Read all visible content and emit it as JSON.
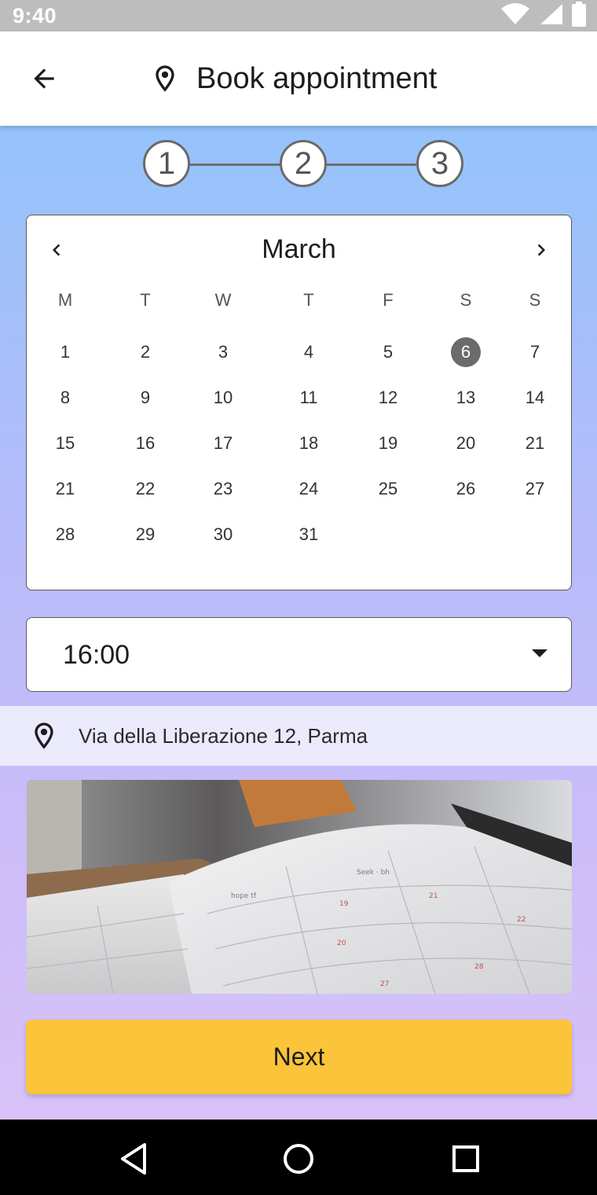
{
  "status_bar": {
    "time": "9:40",
    "icons": [
      "wifi-icon",
      "cell-signal-icon",
      "battery-icon"
    ]
  },
  "app_bar": {
    "title": "Book appointment",
    "back_icon": "arrow-back-icon",
    "title_icon": "location-pin-icon"
  },
  "stepper": {
    "steps": [
      "1",
      "2",
      "3"
    ]
  },
  "calendar": {
    "month": "March",
    "prev_icon": "chevron-left-icon",
    "next_icon": "chevron-right-icon",
    "weekdays": [
      "M",
      "T",
      "W",
      "T",
      "F",
      "S",
      "S"
    ],
    "weeks": [
      [
        "1",
        "2",
        "3",
        "4",
        "5",
        "6",
        "7"
      ],
      [
        "8",
        "9",
        "10",
        "11",
        "12",
        "13",
        "14"
      ],
      [
        "15",
        "16",
        "17",
        "18",
        "19",
        "20",
        "21"
      ],
      [
        "21",
        "22",
        "23",
        "24",
        "25",
        "26",
        "27"
      ],
      [
        "28",
        "29",
        "30",
        "31",
        "",
        "",
        ""
      ]
    ],
    "selected_day": "6"
  },
  "time_select": {
    "value": "16:00",
    "dropdown_icon": "caret-down-icon"
  },
  "address": {
    "text": "Via della Liberazione 12, Parma",
    "icon": "location-pin-icon"
  },
  "photo": {
    "subject": "open-planner-calendar-photo"
  },
  "next_button": {
    "label": "Next"
  },
  "colors": {
    "gradient_top": "#95c3fb",
    "gradient_bottom": "#d8c2f8",
    "accent_button": "#fcc43a",
    "selected_day": "#6b6b6b",
    "address_bar": "#ebeafd"
  },
  "nav_bar": {
    "buttons": [
      "back-triangle-icon",
      "home-circle-icon",
      "recents-square-icon"
    ]
  }
}
